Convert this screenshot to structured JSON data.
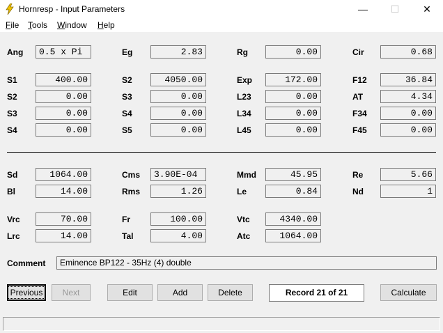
{
  "window": {
    "title": "Hornresp - Input Parameters",
    "icon": "lightning-bolt-icon",
    "controls": {
      "minimize": "—",
      "maximize": "☐",
      "close": "✕"
    }
  },
  "menu": [
    "File",
    "Tools",
    "Window",
    "Help"
  ],
  "params": {
    "ang": {
      "label": "Ang",
      "value": "0.5 x Pi"
    },
    "eg": {
      "label": "Eg",
      "value": "2.83"
    },
    "rg": {
      "label": "Rg",
      "value": "0.00"
    },
    "cir": {
      "label": "Cir",
      "value": "0.68"
    },
    "s1a": {
      "label": "S1",
      "value": "400.00"
    },
    "s2a": {
      "label": "S2",
      "value": "4050.00"
    },
    "exp": {
      "label": "Exp",
      "value": "172.00"
    },
    "f12": {
      "label": "F12",
      "value": "36.84"
    },
    "s2b": {
      "label": "S2",
      "value": "0.00"
    },
    "s3a": {
      "label": "S3",
      "value": "0.00"
    },
    "l23": {
      "label": "L23",
      "value": "0.00"
    },
    "at": {
      "label": "AT",
      "value": "4.34"
    },
    "s3b": {
      "label": "S3",
      "value": "0.00"
    },
    "s4a": {
      "label": "S4",
      "value": "0.00"
    },
    "l34": {
      "label": "L34",
      "value": "0.00"
    },
    "f34": {
      "label": "F34",
      "value": "0.00"
    },
    "s4b": {
      "label": "S4",
      "value": "0.00"
    },
    "s5": {
      "label": "S5",
      "value": "0.00"
    },
    "l45": {
      "label": "L45",
      "value": "0.00"
    },
    "f45": {
      "label": "F45",
      "value": "0.00"
    },
    "sd": {
      "label": "Sd",
      "value": "1064.00"
    },
    "cms": {
      "label": "Cms",
      "value": "3.90E-04"
    },
    "mmd": {
      "label": "Mmd",
      "value": "45.95"
    },
    "re": {
      "label": "Re",
      "value": "5.66"
    },
    "bl": {
      "label": "Bl",
      "value": "14.00"
    },
    "rms": {
      "label": "Rms",
      "value": "1.26"
    },
    "le": {
      "label": "Le",
      "value": "0.84"
    },
    "nd": {
      "label": "Nd",
      "value": "1"
    },
    "vrc": {
      "label": "Vrc",
      "value": "70.00"
    },
    "fr": {
      "label": "Fr",
      "value": "100.00"
    },
    "vtc": {
      "label": "Vtc",
      "value": "4340.00"
    },
    "lrc": {
      "label": "Lrc",
      "value": "14.00"
    },
    "tal": {
      "label": "Tal",
      "value": "4.00"
    },
    "atc": {
      "label": "Atc",
      "value": "1064.00"
    }
  },
  "comment": {
    "label": "Comment",
    "value": "Eminence BP122 - 35Hz (4) double"
  },
  "buttons": {
    "previous": "Previous",
    "next": "Next",
    "edit": "Edit",
    "add": "Add",
    "delete": "Delete",
    "calculate": "Calculate"
  },
  "record": "Record 21 of 21"
}
